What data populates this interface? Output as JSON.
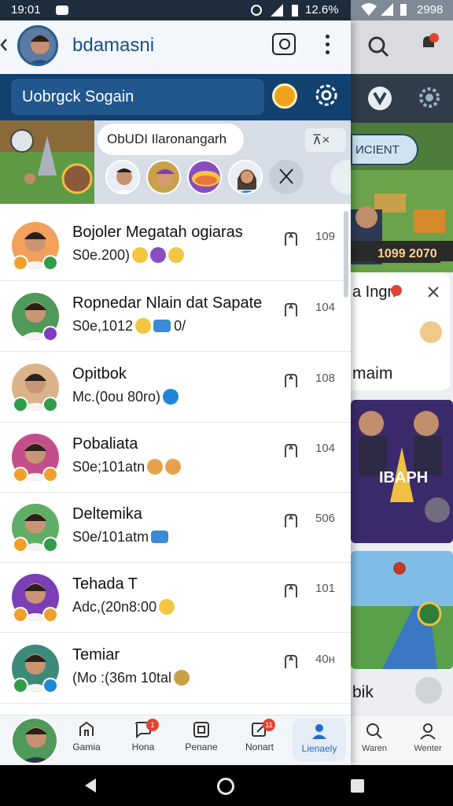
{
  "status": {
    "time": "19:01",
    "battery": "12.6%",
    "right_battery": "2998"
  },
  "header": {
    "title": "bdamasni"
  },
  "search": {
    "placeholder": "Uobrgck Sogain"
  },
  "stories_strip": {
    "prompt": "ObUDI Ilaronangarh",
    "filter_label": "⊼×"
  },
  "chats": [
    {
      "name": "Bojoler Megatah ogiaras",
      "message": "S0e.200)",
      "time": "109",
      "avatar_color": "#f3a15a",
      "badge1": "#f0a02a",
      "badge2": "#2f9d4a",
      "emojis": [
        "#f4c542",
        "#8b4cc2",
        "#f4c542"
      ]
    },
    {
      "name": "Ropnedar Nlain dat Sapate",
      "message": "S0e,1012",
      "msg_tail": "0/",
      "time": "104",
      "avatar_color": "#4f9a5a",
      "badge1": "",
      "badge2": "#7d3cc2",
      "emojis": [
        "#f4c542"
      ],
      "chip": "#3a8ad6"
    },
    {
      "name": "Opitbok",
      "message": "Mc.(0ou 80ro)",
      "time": "108",
      "avatar_color": "#d9b48a",
      "badge1": "#2f9d4a",
      "badge2": "#2f9d4a",
      "emojis": [
        "#1e88d6"
      ]
    },
    {
      "name": "Pobaliata",
      "message": "S0e;101atn",
      "time": "104",
      "avatar_color": "#c24f8a",
      "badge1": "#f0a02a",
      "badge2": "#f0a02a",
      "emojis": [
        "#e8a14a",
        "#e8a14a"
      ]
    },
    {
      "name": "Deltemika",
      "message": "S0e/101atm",
      "time": "506",
      "avatar_color": "#5fae68",
      "badge1": "#f0a02a",
      "badge2": "#2f9d4a",
      "emojis": [],
      "chip": "#3a8ad6"
    },
    {
      "name": "Tehada T",
      "message": "Adc,(20n8:00",
      "time": "101",
      "avatar_color": "#7a3fb5",
      "badge1": "#f0a02a",
      "badge2": "#f0a02a",
      "emojis": [
        "#f4c542"
      ]
    },
    {
      "name": "Temiar",
      "message": "(Mo :(36m 10tal",
      "time": "40н",
      "avatar_color": "#3d8a7a",
      "badge1": "#2f9d4a",
      "badge2": "#1e88d6",
      "emojis": [
        "#c9a04a"
      ]
    }
  ],
  "tabs": [
    {
      "label": "Gamia",
      "icon": "home-icon",
      "badge": ""
    },
    {
      "label": "Hona",
      "icon": "chat-icon",
      "badge": "1"
    },
    {
      "label": "Penane",
      "icon": "square-icon",
      "badge": ""
    },
    {
      "label": "Nonart",
      "icon": "edit-icon",
      "badge": "11"
    },
    {
      "label": "Lienaely",
      "icon": "profile-icon",
      "badge": "",
      "active": true
    }
  ],
  "background_panel": {
    "pill_text": "ИCIENT",
    "score": "1099 2070",
    "card_title": "a Ingn",
    "card_sub": "maim",
    "banner_text": "IBAPH",
    "bottom_text": "bik",
    "nav": [
      {
        "label": "Waren"
      },
      {
        "label": "Wenter"
      }
    ]
  },
  "colors": {
    "brand_blue": "#1d4f86",
    "search_band": "#12406f",
    "active_tab": "#1d6fc7",
    "badge_red": "#e2442f"
  }
}
